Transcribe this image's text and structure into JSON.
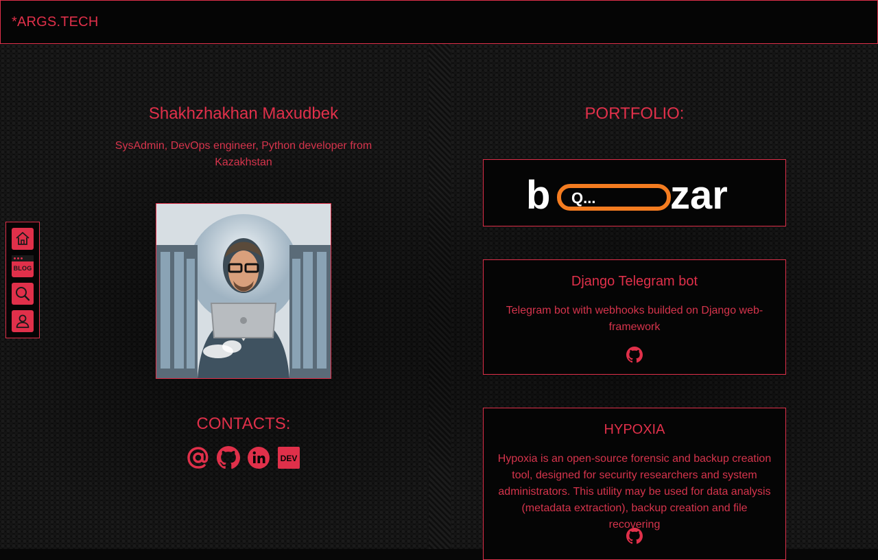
{
  "header": {
    "brand": "*ARGS.TECH"
  },
  "sidenav": {
    "items": [
      {
        "name": "home",
        "icon": "home-icon"
      },
      {
        "name": "blog",
        "icon": "blog-icon",
        "label": "BLOG"
      },
      {
        "name": "search",
        "icon": "search-icon"
      },
      {
        "name": "profile",
        "icon": "user-icon"
      }
    ]
  },
  "profile": {
    "name": "Shakhzhakhan Maxudbek",
    "bio": "SysAdmin, DevOps engineer, Python developer from Kazakhstan",
    "photo_alt": "avatar-illustration"
  },
  "contacts": {
    "title": "CONTACTS:",
    "icons": [
      "email-icon",
      "github-icon",
      "linkedin-icon",
      "dev-icon"
    ],
    "dev_label": "DEV"
  },
  "portfolio": {
    "title": "PORTFOLIO:",
    "projects": [
      {
        "logo_text_left": "b",
        "logo_search_text": "Q...",
        "logo_text_right": "zar",
        "logo_accent": "#f47c20"
      },
      {
        "title": "Django Telegram bot",
        "description": "Telegram bot with webhooks builded on Django web-framework",
        "link_icon": "github-icon"
      },
      {
        "title": "HYPOXIA",
        "description": "Hypoxia is an open-source forensic and backup creation tool, designed for security researchers and system administrators. This utility may be used for data analysis (metadata extraction), backup creation and file recovering",
        "link_icon": "github-icon"
      }
    ]
  },
  "colors": {
    "accent": "#e0304a",
    "background": "#070707"
  }
}
